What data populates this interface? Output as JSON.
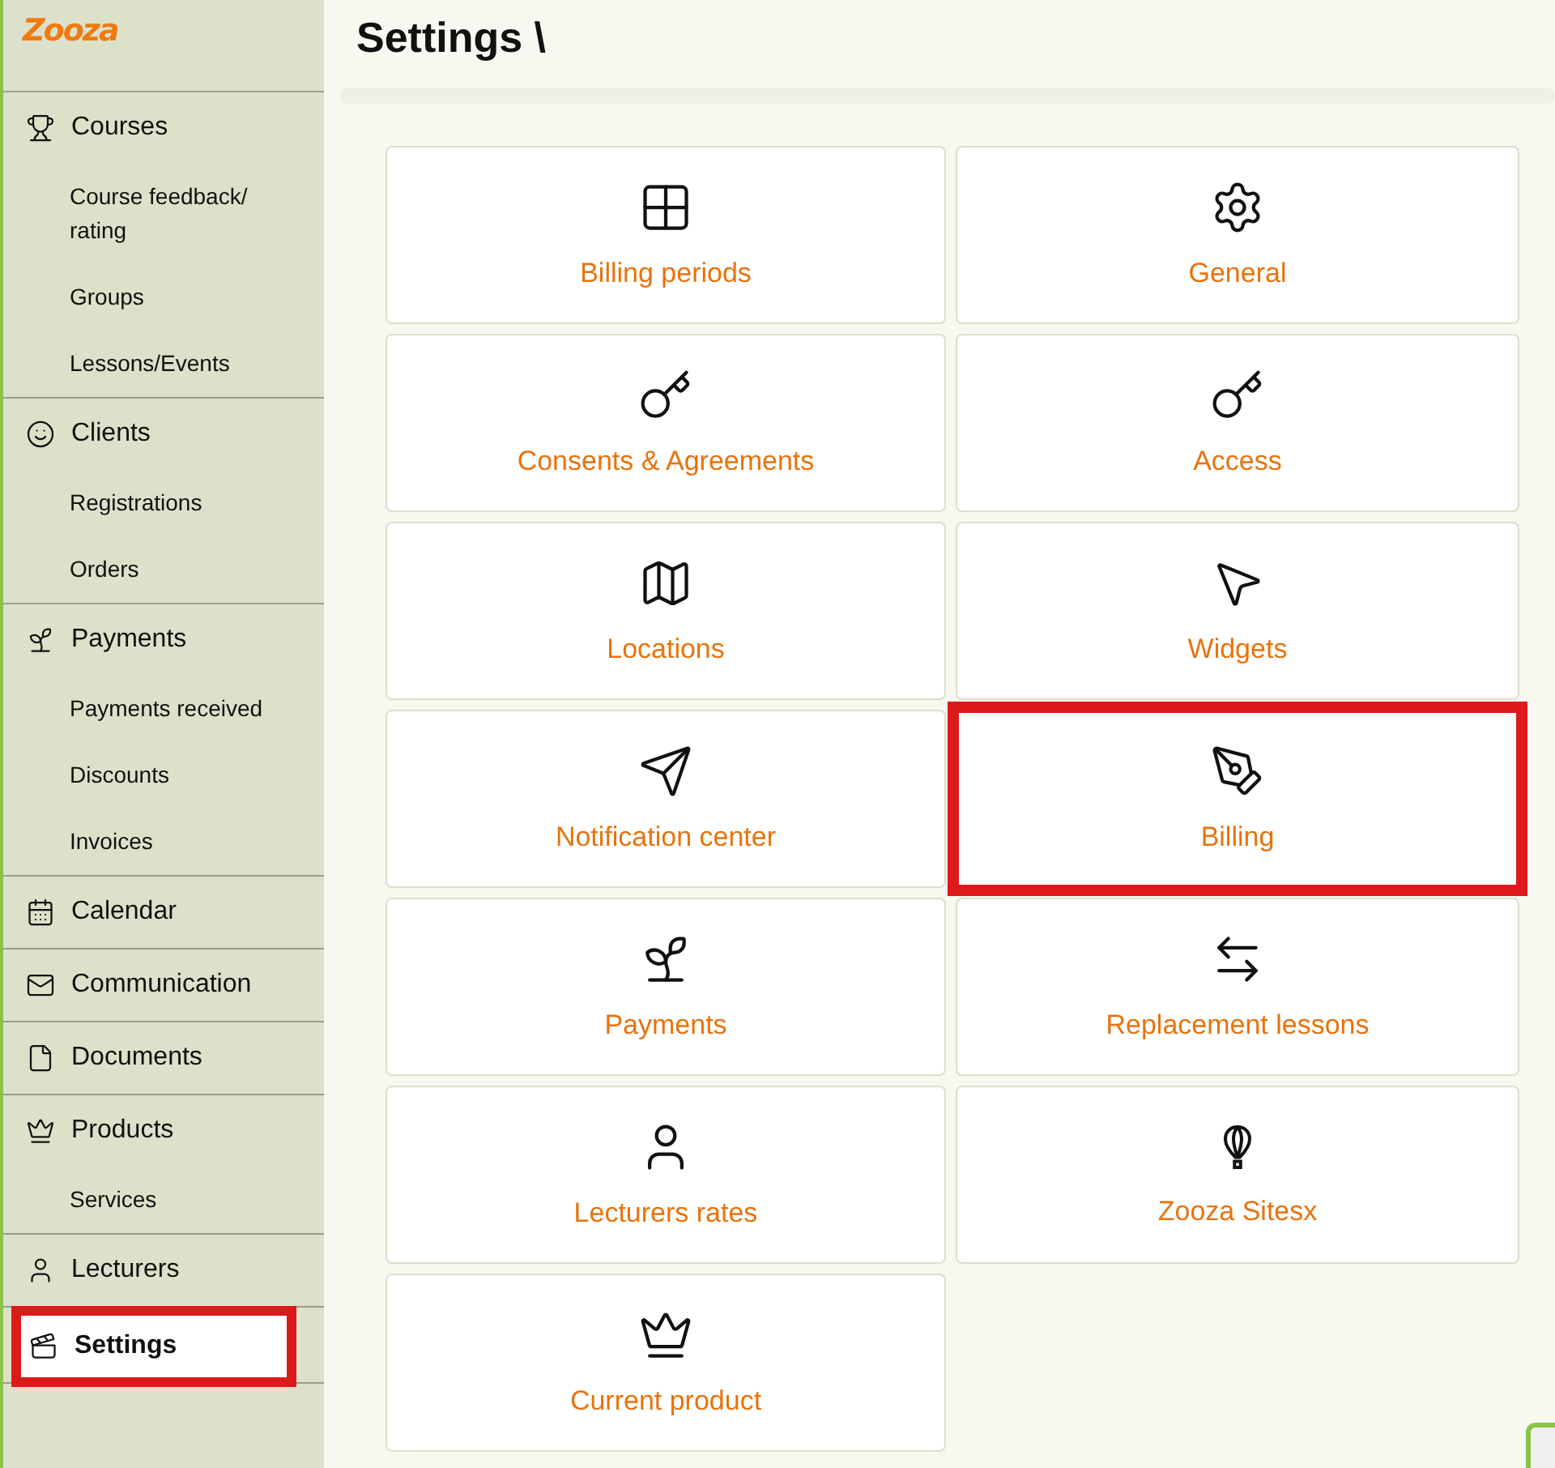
{
  "logo": "Zooza",
  "sidebar": {
    "groups": [
      {
        "label": "Courses",
        "selected": false,
        "highlighted": false,
        "children": [
          {
            "label": "Course feedback/ rating"
          },
          {
            "label": "Groups"
          },
          {
            "label": "Lessons/Events"
          }
        ]
      },
      {
        "label": "Clients",
        "selected": false,
        "highlighted": false,
        "children": [
          {
            "label": "Registrations"
          },
          {
            "label": "Orders"
          }
        ]
      },
      {
        "label": "Payments",
        "selected": false,
        "highlighted": false,
        "children": [
          {
            "label": "Payments received"
          },
          {
            "label": "Discounts"
          },
          {
            "label": "Invoices"
          }
        ]
      },
      {
        "label": "Calendar",
        "selected": false,
        "highlighted": false
      },
      {
        "label": "Communication",
        "selected": false,
        "highlighted": false
      },
      {
        "label": "Documents",
        "selected": false,
        "highlighted": false
      },
      {
        "label": "Products",
        "selected": false,
        "highlighted": false,
        "children": [
          {
            "label": "Services"
          }
        ]
      },
      {
        "label": "Lecturers",
        "selected": false,
        "highlighted": false
      },
      {
        "label": "Settings",
        "selected": true,
        "highlighted": true
      }
    ]
  },
  "page": {
    "title": "Settings \\"
  },
  "cards": [
    {
      "label": "Billing periods",
      "highlighted": false
    },
    {
      "label": "General",
      "highlighted": false
    },
    {
      "label": "Consents & Agreements",
      "highlighted": false
    },
    {
      "label": "Access",
      "highlighted": false
    },
    {
      "label": "Locations",
      "highlighted": false
    },
    {
      "label": "Widgets",
      "highlighted": false
    },
    {
      "label": "Notification center",
      "highlighted": false
    },
    {
      "label": "Billing",
      "highlighted": true
    },
    {
      "label": "Payments",
      "highlighted": false
    },
    {
      "label": "Replacement lessons",
      "highlighted": false
    },
    {
      "label": "Lecturers rates",
      "highlighted": false
    },
    {
      "label": "Zooza Sitesx",
      "highlighted": false
    },
    {
      "label": "Current product",
      "highlighted": false
    }
  ]
}
